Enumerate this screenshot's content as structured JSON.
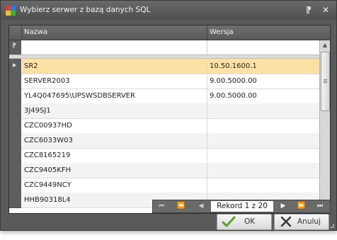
{
  "window": {
    "title": "Wybierz serwer z bazą danych SQL",
    "pin_glyph": "⁋",
    "close_glyph": "✕"
  },
  "grid": {
    "columns": [
      "Nazwa",
      "Wersja"
    ],
    "filter_glyph": "⁋",
    "selected_indicator": "▶",
    "rows": [
      {
        "name": "SR2",
        "version": "10.50.1600.1"
      },
      {
        "name": "SERVER2003",
        "version": "9.00.5000.00"
      },
      {
        "name": "YL4Q047695\\UPSWSDBSERVER",
        "version": "9.00.5000.00"
      },
      {
        "name": "3J49SJ1",
        "version": ""
      },
      {
        "name": "CZC00937HD",
        "version": ""
      },
      {
        "name": "CZC6033W03",
        "version": ""
      },
      {
        "name": "CZC8165219",
        "version": ""
      },
      {
        "name": "CZC9405KFH",
        "version": ""
      },
      {
        "name": "CZC9449NCY",
        "version": ""
      },
      {
        "name": "HHB90318L4",
        "version": ""
      }
    ]
  },
  "navigator": {
    "first": "⏮",
    "prev_page": "⏪",
    "prev": "◀",
    "counter": "Rekord 1 z 20",
    "next": "▶",
    "next_page": "⏩",
    "last": "⏭"
  },
  "buttons": {
    "ok": "OK",
    "cancel": "Anuluj"
  },
  "colors": {
    "selected_row": "#fbe2a4",
    "ok_check": "#5aa02c",
    "cancel_x": "#333333"
  }
}
